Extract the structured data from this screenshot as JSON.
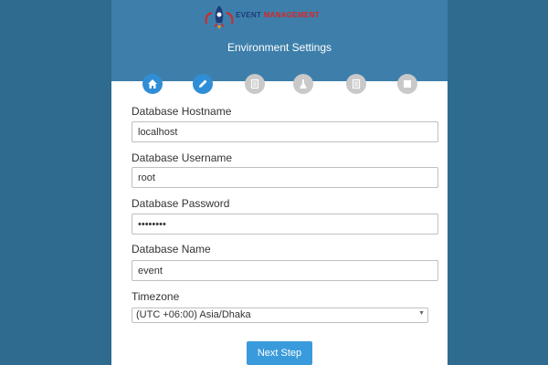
{
  "app": {
    "logo_text_primary": "EVENT",
    "logo_text_secondary": "MANAGEMENT",
    "page_title": "Environment Settings"
  },
  "steps": [
    {
      "icon": "home-icon",
      "state": "active"
    },
    {
      "icon": "pencil-icon",
      "state": "active"
    },
    {
      "icon": "document-icon",
      "state": "inactive"
    },
    {
      "icon": "flask-icon",
      "state": "inactive"
    },
    {
      "icon": "document-icon",
      "state": "inactive"
    },
    {
      "icon": "square-icon",
      "state": "inactive"
    }
  ],
  "form": {
    "hostname_label": "Database Hostname",
    "hostname_value": "localhost",
    "username_label": "Database Username",
    "username_value": "root",
    "password_label": "Database Password",
    "password_value": "secret12",
    "name_label": "Database Name",
    "name_value": "event",
    "timezone_label": "Timezone",
    "timezone_value": "(UTC +06:00) Asia/Dhaka",
    "next_label": "Next Step"
  },
  "colors": {
    "page_bg": "#2e6b8f",
    "header_bg": "#3d7faa",
    "step_active": "#2f8ed6",
    "step_inactive": "#c9c9c9",
    "button_bg": "#3a9bdc"
  }
}
